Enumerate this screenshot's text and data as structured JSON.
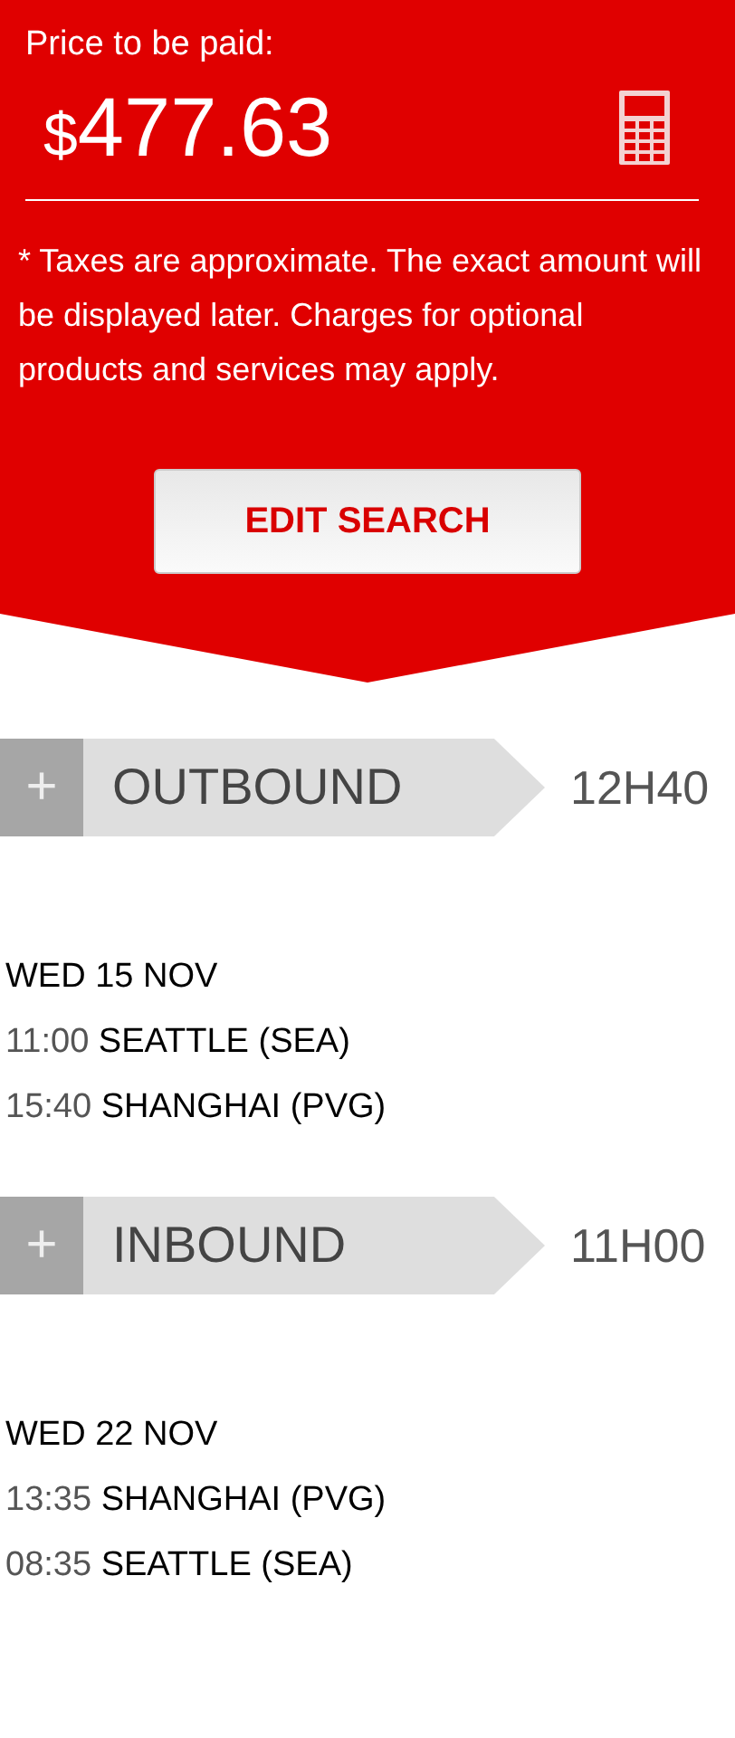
{
  "price": {
    "label": "Price to be paid:",
    "currency": "$",
    "amount": "477.63",
    "note": "* Taxes are approximate. The exact amount will be displayed later. Charges for optional products and services may apply."
  },
  "edit_button": "EDIT SEARCH",
  "legs": [
    {
      "toggle": "+",
      "title": "OUTBOUND",
      "duration": "12H40",
      "date": "WED 15 NOV",
      "stops": [
        {
          "time": "11:00",
          "place": "SEATTLE (SEA)"
        },
        {
          "time": "15:40",
          "place": "SHANGHAI (PVG)"
        }
      ]
    },
    {
      "toggle": "+",
      "title": "INBOUND",
      "duration": "11H00",
      "date": "WED 22 NOV",
      "stops": [
        {
          "time": "13:35",
          "place": "SHANGHAI (PVG)"
        },
        {
          "time": "08:35",
          "place": "SEATTLE (SEA)"
        }
      ]
    }
  ]
}
